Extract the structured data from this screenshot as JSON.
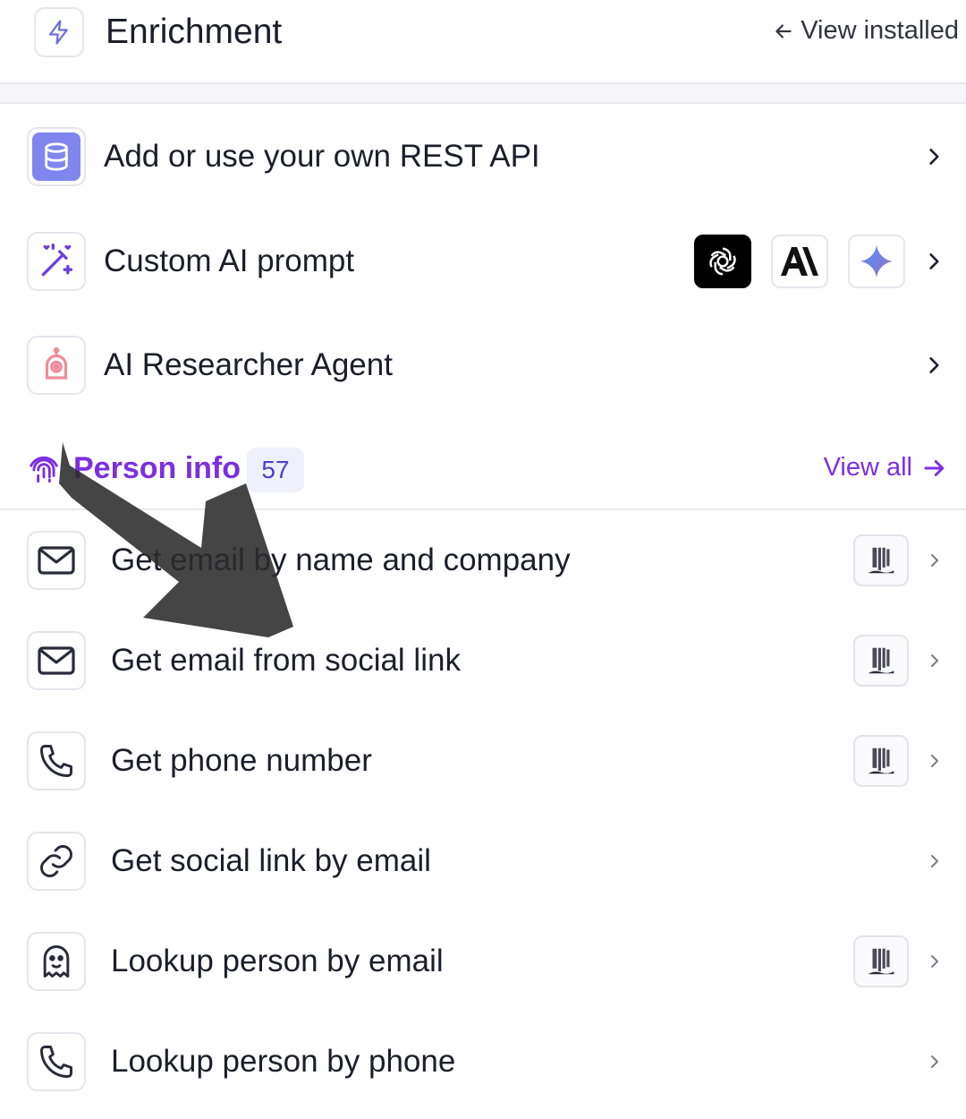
{
  "header": {
    "title": "Enrichment",
    "view_installed_label": "View installed"
  },
  "top_items": [
    {
      "label": "Add or use your own REST API",
      "icon": "database-icon"
    },
    {
      "label": "Custom AI prompt",
      "icon": "magic-wand-icon",
      "providers": [
        "openai-logo",
        "anthropic-logo",
        "gemini-logo"
      ]
    },
    {
      "label": "AI Researcher Agent",
      "icon": "robot-icon"
    }
  ],
  "section": {
    "title": "Person info",
    "count": "57",
    "view_all_label": "View all",
    "icon": "fingerprint-icon"
  },
  "person_items": [
    {
      "label": "Get email by name and company",
      "icon": "mail-icon",
      "waterfall": true
    },
    {
      "label": "Get email from social link",
      "icon": "mail-icon",
      "waterfall": true
    },
    {
      "label": "Get phone number",
      "icon": "phone-icon",
      "waterfall": true
    },
    {
      "label": "Get social link by email",
      "icon": "link-icon",
      "waterfall": false
    },
    {
      "label": "Lookup person by email",
      "icon": "ghost-icon",
      "waterfall": true
    },
    {
      "label": "Lookup person by phone",
      "icon": "phone-icon",
      "waterfall": false
    }
  ],
  "colors": {
    "accent": "#7c2fe0",
    "badge_bg": "#eef0fb",
    "badge_text": "#4a3fd0",
    "db_icon_bg": "#7f86ef",
    "robot_icon": "#f08a9a"
  }
}
